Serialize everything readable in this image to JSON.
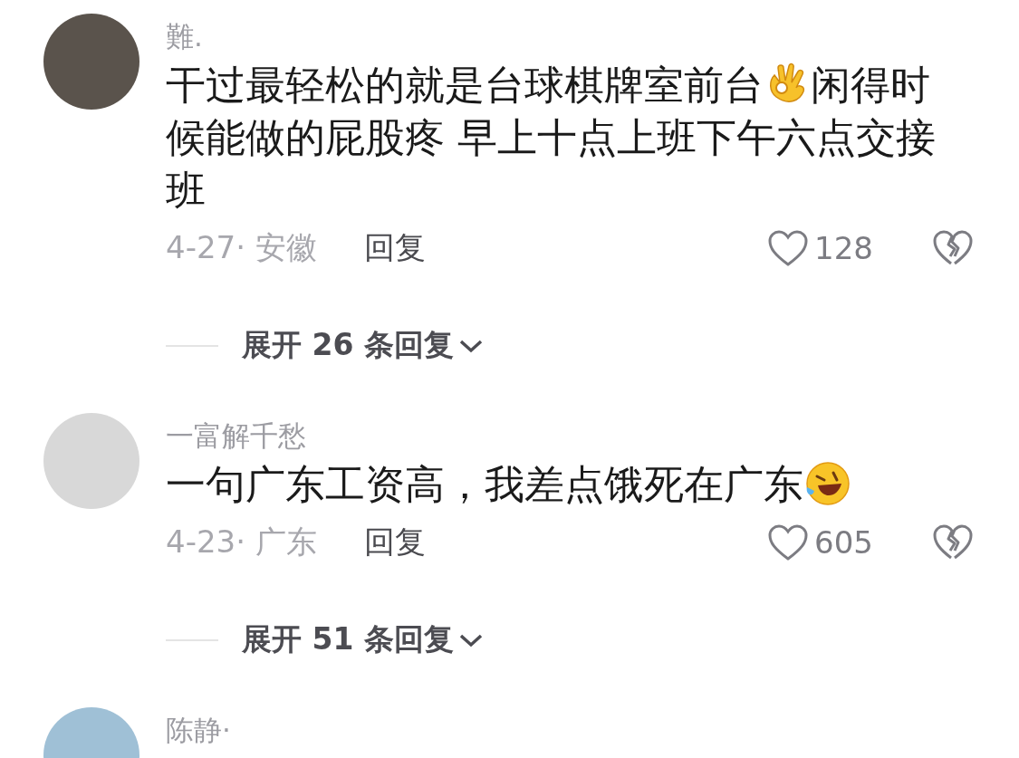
{
  "comments": [
    {
      "username": "難.",
      "lines": [
        [
          {
            "kind": "text",
            "text": "干过最轻松的就是台球棋牌室前台"
          },
          {
            "kind": "ok_hand"
          },
          {
            "kind": "text",
            "text": "闲得时"
          }
        ],
        [
          {
            "kind": "text",
            "text": "候能做的屁股疼 早上十点上班下午六点交接"
          }
        ],
        [
          {
            "kind": "text",
            "text": "班"
          }
        ]
      ],
      "date_location": "4-27· 安徽",
      "reply": "回复",
      "likes": "128",
      "expand": "展开 26 条回复"
    },
    {
      "username": "一富解千愁",
      "lines": [
        [
          {
            "kind": "text",
            "text": "一句广东工资高，我差点饿死在广东"
          },
          {
            "kind": "laughing"
          }
        ]
      ],
      "date_location": "4-23· 广东",
      "reply": "回复",
      "likes": "605",
      "expand": "展开 51 条回复"
    },
    {
      "username": "陈静·"
    }
  ]
}
